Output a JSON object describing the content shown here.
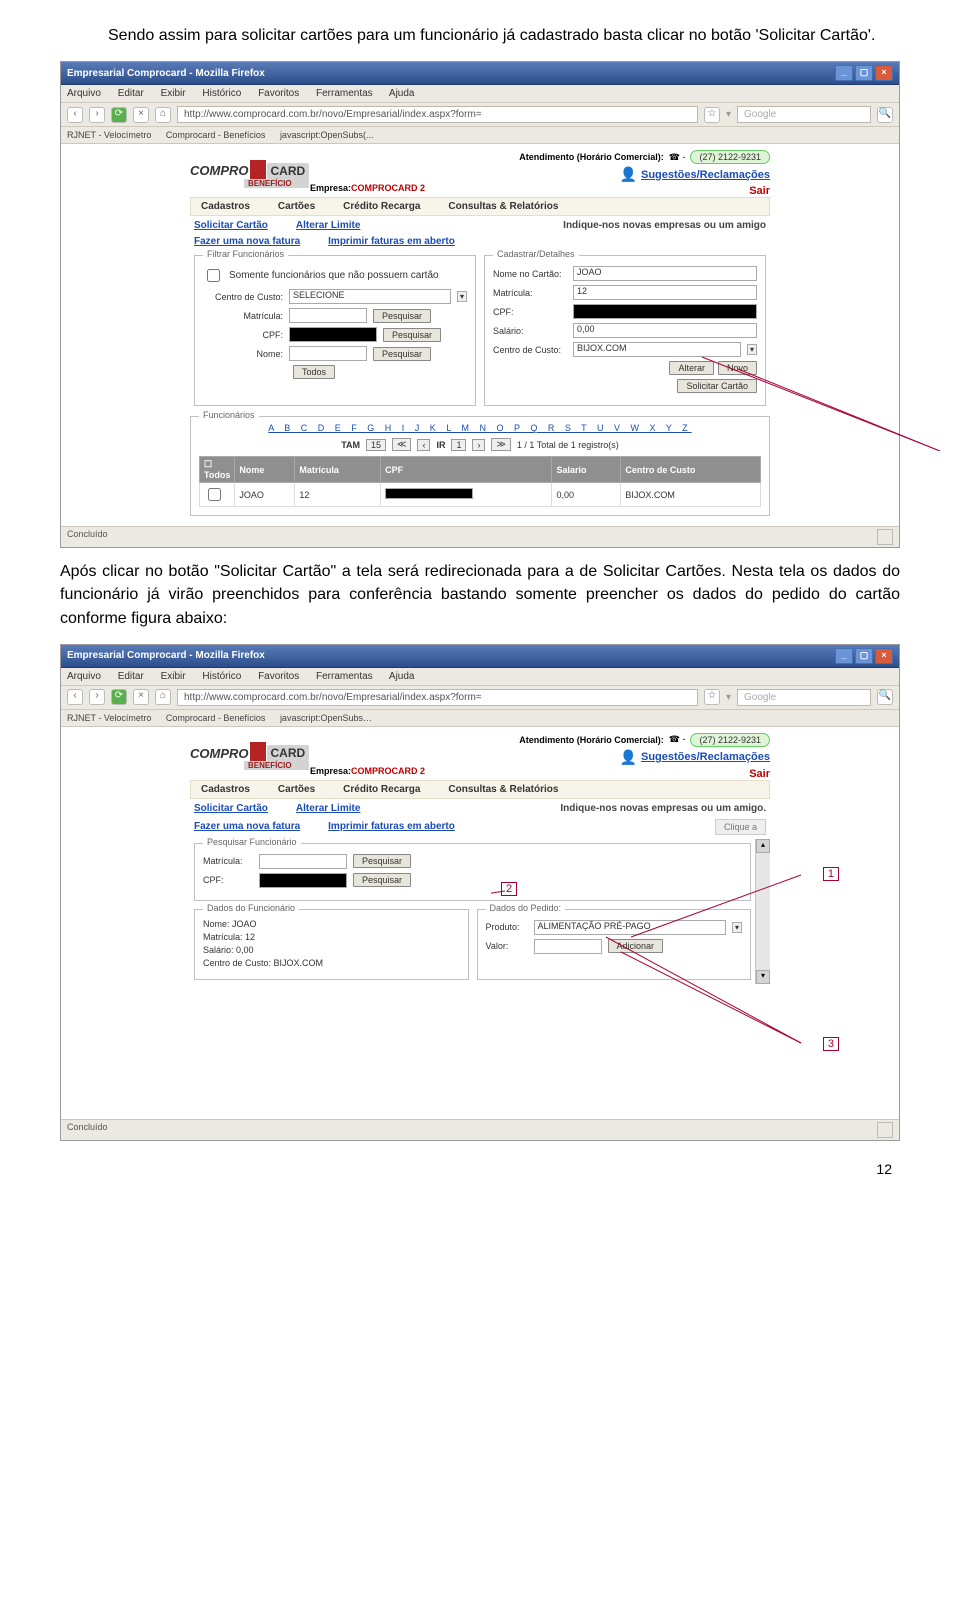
{
  "para1": "Sendo assim para solicitar cartões para um funcionário já cadastrado basta clicar no botão 'Solicitar Cartão'.",
  "para2": "Após clicar no botão \"Solicitar Cartão\" a tela será redirecionada para a de Solicitar Cartões. Nesta tela os dados do funcionário já virão preenchidos para conferência bastando somente preencher os dados do pedido do cartão conforme figura abaixo:",
  "page_number": "12",
  "browser": {
    "title": "Empresarial Comprocard - Mozilla Firefox",
    "menu": [
      "Arquivo",
      "Editar",
      "Exibir",
      "Histórico",
      "Favoritos",
      "Ferramentas",
      "Ajuda"
    ],
    "url": "http://www.comprocard.com.br/novo/Empresarial/index.aspx?form=",
    "bookmarks": [
      "RJNET - Velocímetro",
      "Comprocard - Benefícios",
      "javascript:OpenSubs(..."
    ],
    "status": "Concluído",
    "search_placeholder": "Google"
  },
  "app": {
    "logo1": "COMPRO",
    "logo2": "CARD",
    "logo3": "BENEFÍCIO",
    "atend_label": "Atendimento (Horário Comercial):",
    "phone": "(27) 2122-9231",
    "sugest": "Sugestões/Reclamações",
    "empresa_label": "Empresa:",
    "empresa_value": "COMPROCARD 2",
    "sair": "Sair",
    "menu": [
      "Cadastros",
      "Cartões",
      "Crédito Recarga",
      "Consultas & Relatórios"
    ],
    "link_solicitar": "Solicitar Cartão",
    "link_alterar": "Alterar Limite",
    "link_fazer": "Fazer uma nova fatura",
    "link_imprimir": "Imprimir faturas em aberto",
    "promo1": "Indique-nos novas empresas ou um amigo",
    "promo2": "Indique-nos novas empresas ou um amigo.",
    "clique": "Clique a"
  },
  "shot1": {
    "filtrar": {
      "legend": "Filtrar Funcionários",
      "chk": "Somente funcionários que não possuem cartão",
      "centro_lbl": "Centro de Custo:",
      "centro_val": "SELECIONE",
      "matricula_lbl": "Matrícula:",
      "cpf_lbl": "CPF:",
      "nome_lbl": "Nome:",
      "btn_pesquisar": "Pesquisar",
      "btn_todos": "Todos"
    },
    "cadastrar": {
      "legend": "Cadastrar/Detalhes",
      "nome_lbl": "Nome no Cartão:",
      "nome_val": "JOAO",
      "matricula_lbl": "Matrícula:",
      "matricula_val": "12",
      "cpf_lbl": "CPF:",
      "salario_lbl": "Salário:",
      "salario_val": "0,00",
      "centro_lbl": "Centro de Custo:",
      "centro_val": "BIJOX.COM",
      "btn_alterar": "Alterar",
      "btn_novo": "Novo",
      "btn_solicitar": "Solicitar Cartão"
    },
    "funcionarios": {
      "legend": "Funcionários",
      "alpha": "A B C D E F G H I J K L M N O P Q R S T U V W X Y Z",
      "pager_tam": "TAM",
      "pager_tam_v": "15",
      "pager_ir": "IR",
      "pager_ir_v": "1",
      "pager_info": "1 / 1 Total de 1 registro(s)",
      "th": [
        "Todos",
        "Nome",
        "Matrícula",
        "CPF",
        "Salario",
        "Centro de Custo"
      ],
      "row": {
        "nome": "JOAO",
        "mat": "12",
        "cpf": "",
        "sal": "0,00",
        "cc": "BIJOX.COM"
      }
    }
  },
  "shot2": {
    "pesq": {
      "legend": "Pesquisar Funcionário",
      "matricula_lbl": "Matrícula:",
      "cpf_lbl": "CPF:",
      "btn": "Pesquisar"
    },
    "dados": {
      "legend": "Dados do Funcionário",
      "nome": "Nome: JOAO",
      "mat": "Matrícula: 12",
      "sal": "Salário: 0,00",
      "cc": "Centro de Custo: BIJOX.COM"
    },
    "pedido": {
      "legend": "Dados do Pedido:",
      "prod_lbl": "Produto:",
      "prod_val": "ALIMENTAÇÃO PRÉ-PAGO",
      "valor_lbl": "Valor:",
      "btn_add": "Adicionar"
    },
    "annot": [
      "1",
      "2",
      "3"
    ]
  }
}
